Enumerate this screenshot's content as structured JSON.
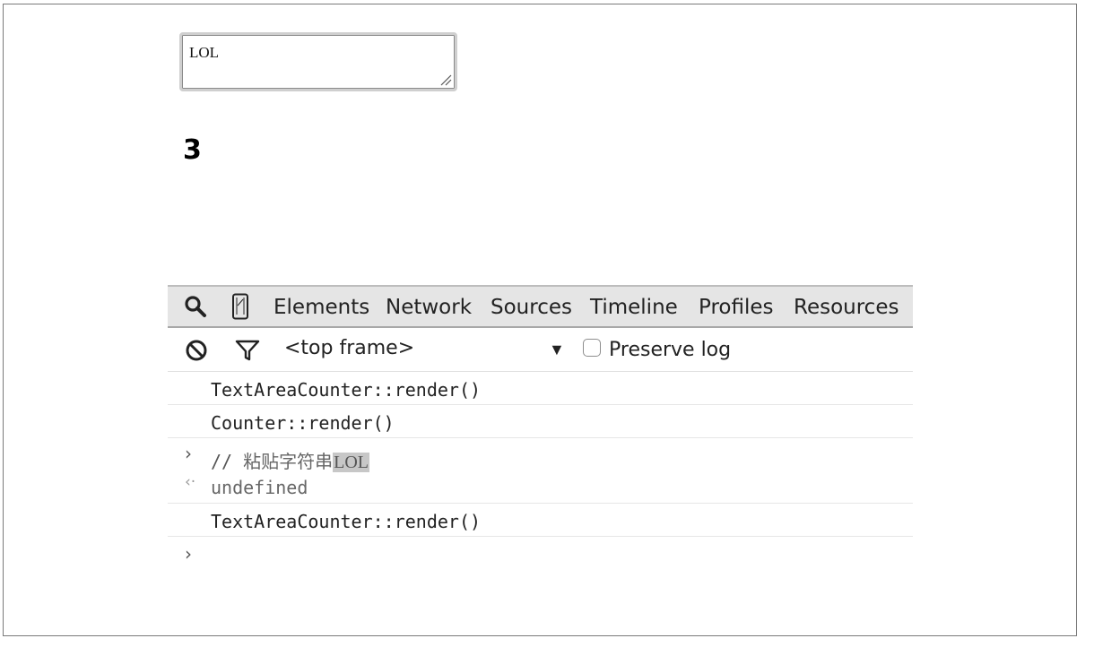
{
  "page": {
    "textarea": {
      "value": "LOL"
    },
    "counter": {
      "value": "3"
    }
  },
  "devtools": {
    "tabs": [
      "Elements",
      "Network",
      "Sources",
      "Timeline",
      "Profiles",
      "Resources"
    ],
    "toolbar": {
      "frame_select": "<top frame>",
      "preserve_log_label": "Preserve log",
      "preserve_log_checked": false
    },
    "console": {
      "lines": [
        "TextAreaCounter::render()",
        "Counter::render()",
        "TextAreaCounter::render()"
      ],
      "input": {
        "comment_prefix": "// ",
        "comment_cjk": "粘贴字符串",
        "comment_selected": "LOL"
      },
      "result": "undefined"
    }
  }
}
